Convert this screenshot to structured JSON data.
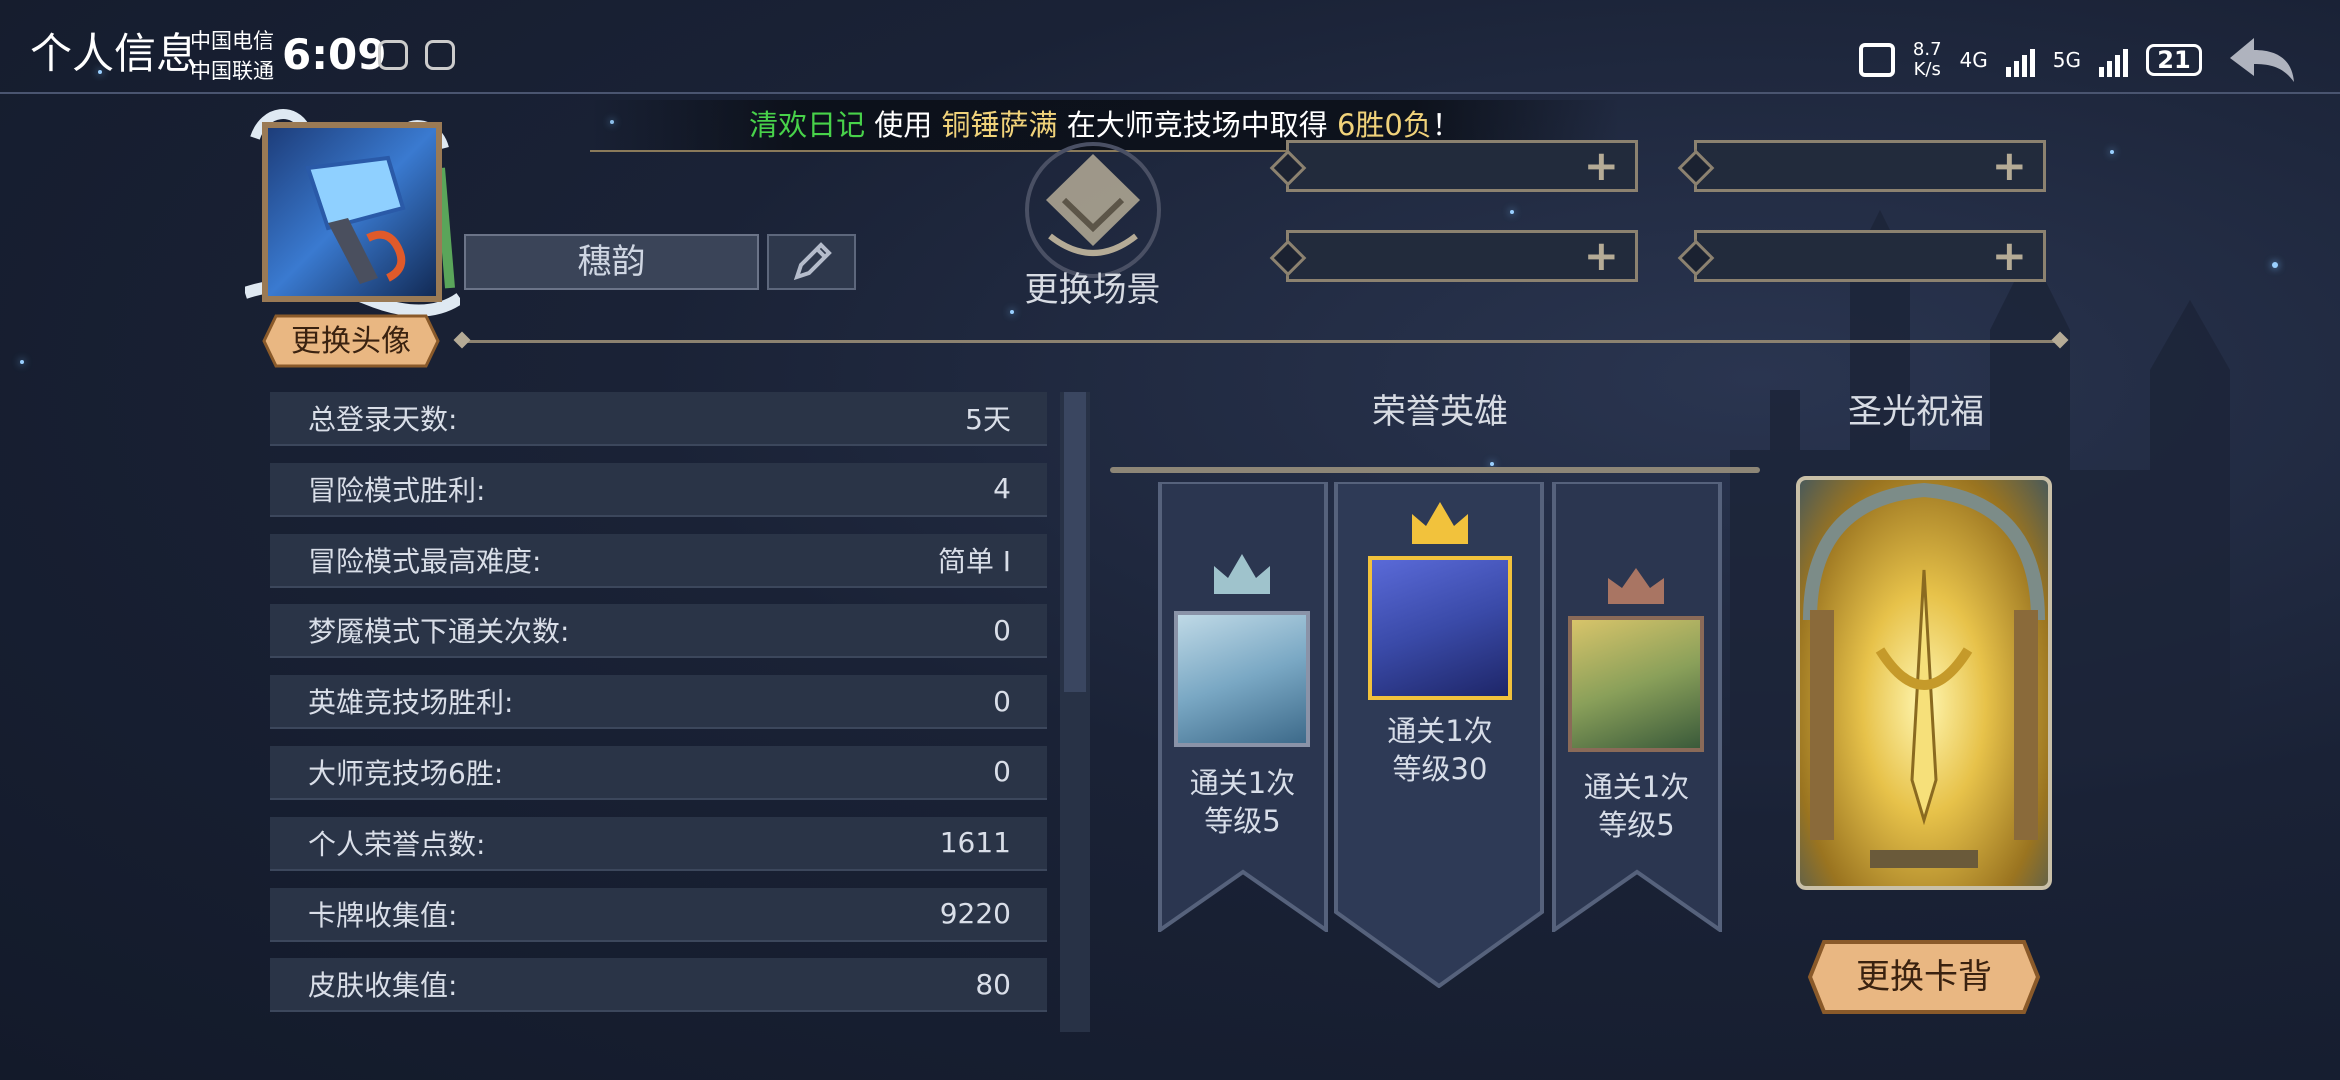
{
  "status_bar": {
    "page_title": "个人信息",
    "carrier_1": "中国电信",
    "carrier_2": "中国联通",
    "time": "6:09",
    "net_speed_value": "8.7",
    "net_speed_unit": "K/s",
    "net_1": "4G",
    "net_2": "5G",
    "battery": "21"
  },
  "banner": {
    "player": "清欢日记",
    "t1": " 使用 ",
    "hero": "铜锤萨满",
    "t2": " 在大师竞技场中取得 ",
    "record": "6胜0负",
    "t3": "！"
  },
  "profile": {
    "name": "穗韵",
    "change_avatar_label": "更换头像",
    "change_scene_label": "更换场景"
  },
  "stats": [
    {
      "label": "总登录天数:",
      "value": "5天"
    },
    {
      "label": "冒险模式胜利:",
      "value": "4"
    },
    {
      "label": "冒险模式最高难度:",
      "value": "简单 I"
    },
    {
      "label": "梦魇模式下通关次数:",
      "value": "0"
    },
    {
      "label": "英雄竞技场胜利:",
      "value": "0"
    },
    {
      "label": "大师竞技场6胜:",
      "value": "0"
    },
    {
      "label": "个人荣誉点数:",
      "value": "1611"
    },
    {
      "label": "卡牌收集值:",
      "value": "9220"
    },
    {
      "label": "皮肤收集值:",
      "value": "80"
    }
  ],
  "honor": {
    "title": "荣誉英雄",
    "heroes": [
      {
        "line1": "通关1次",
        "line2": "等级5",
        "crown": "#9fc3cc"
      },
      {
        "line1": "通关1次",
        "line2": "等级30",
        "crown": "#f2c23c"
      },
      {
        "line1": "通关1次",
        "line2": "等级5",
        "crown": "#a97563"
      }
    ]
  },
  "blessing": {
    "title": "圣光祝福",
    "change_cardback_label": "更换卡背"
  }
}
